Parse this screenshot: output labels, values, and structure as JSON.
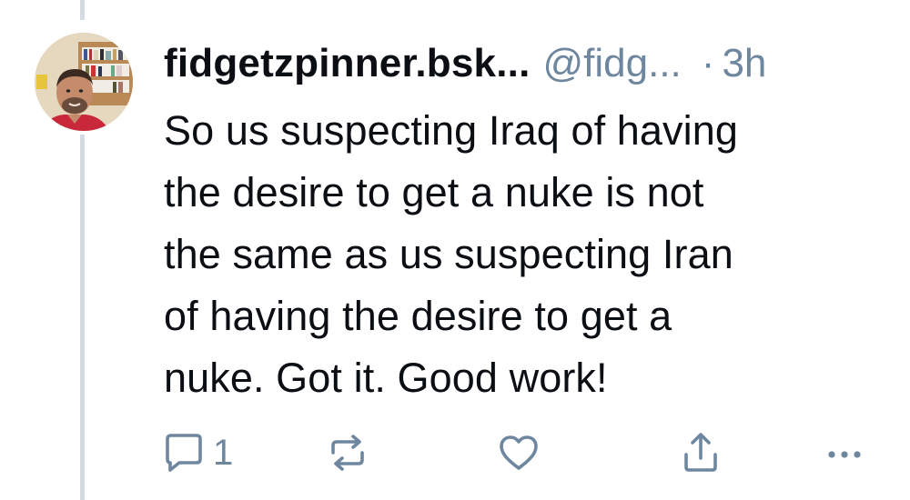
{
  "post": {
    "display_name": "fidgetzpinner.bsk...",
    "handle": "@fidg...",
    "separator": "·",
    "time": "3h",
    "text": "So us suspecting Iraq of having\nthe desire to get a nuke is not\nthe same as us suspecting Iran\nof having the desire to get a\nnuke. Got it. Good work!"
  },
  "actions": {
    "reply_count": "1",
    "reply_icon": "reply-bubble-icon",
    "repost_icon": "repost-icon",
    "like_icon": "heart-icon",
    "share_icon": "share-icon",
    "more_icon": "more-dots-icon"
  },
  "colors": {
    "text": "#0b0f14",
    "muted": "#6f869f",
    "thread_line": "#d4dbe2",
    "background": "#ffffff"
  }
}
